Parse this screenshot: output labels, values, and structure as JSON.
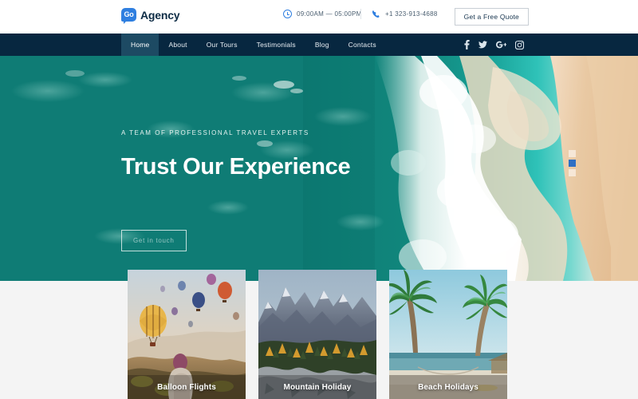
{
  "topbar": {
    "logo": {
      "badge": "Go",
      "name": "Agency"
    },
    "hours": {
      "icon": "clock-icon",
      "text": "09:00AM — 05:00PM"
    },
    "phone": {
      "icon": "phone-icon",
      "text": "+1 323-913-4688"
    },
    "quote_button": "Get a Free Quote"
  },
  "nav": {
    "items": [
      {
        "label": "Home",
        "active": true
      },
      {
        "label": "About",
        "active": false
      },
      {
        "label": "Our Tours",
        "active": false
      },
      {
        "label": "Testimonials",
        "active": false
      },
      {
        "label": "Blog",
        "active": false
      },
      {
        "label": "Contacts",
        "active": false
      }
    ],
    "socials": [
      {
        "name": "facebook-icon"
      },
      {
        "name": "twitter-icon"
      },
      {
        "name": "google-plus-icon"
      },
      {
        "name": "instagram-icon"
      }
    ]
  },
  "hero": {
    "subtitle": "A TEAM OF PROFESSIONAL TRAVEL EXPERTS",
    "title": "Trust Our Experience",
    "cta": "Get in touch",
    "slides": {
      "total": 3,
      "active": 2
    }
  },
  "cards": [
    {
      "title": "Balloon Flights"
    },
    {
      "title": "Mountain Holiday"
    },
    {
      "title": "Beach Holidays"
    }
  ],
  "colors": {
    "nav_bg": "#072740",
    "nav_active": "#1d4a63",
    "accent_blue": "#2f7fe0",
    "ocean_teal": "#12827a",
    "page_bg": "#f4f4f4"
  }
}
